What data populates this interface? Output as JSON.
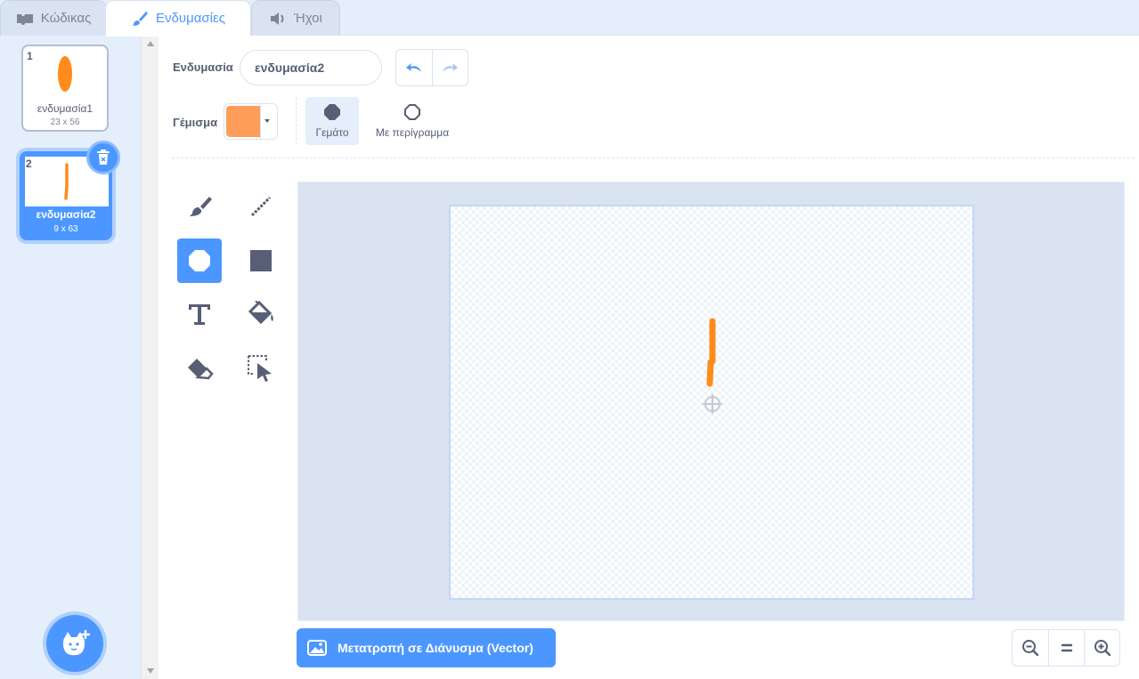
{
  "tabs": [
    {
      "label": "Κώδικας",
      "icon": "code-icon",
      "state": "inactive"
    },
    {
      "label": "Ενδυμασίες",
      "icon": "brush-icon",
      "state": "active"
    },
    {
      "label": "Ήχοι",
      "icon": "speaker-icon",
      "state": "inactive"
    }
  ],
  "costumes": [
    {
      "index": "1",
      "name": "ενδυμασία1",
      "size": "23 x 56",
      "selected": false
    },
    {
      "index": "2",
      "name": "ενδυμασία2",
      "size": "9 x 63",
      "selected": true
    }
  ],
  "editor": {
    "costume_label": "Ενδυμασία",
    "costume_name": "ενδυμασία2",
    "fill_label": "Γέμισμα",
    "fill_color": "#ff9e5a",
    "modes": {
      "filled": "Γεμάτο",
      "outlined": "Με περίγραμμα"
    },
    "selected_mode": "filled",
    "active_tool": "circle-tool"
  },
  "convert_button": "Μετατροπή σε Διάνυσμα (Vector)",
  "colors": {
    "accent": "#4c97ff",
    "sprite_orange": "#ff8c1a",
    "panel_bg": "#e5effb"
  }
}
